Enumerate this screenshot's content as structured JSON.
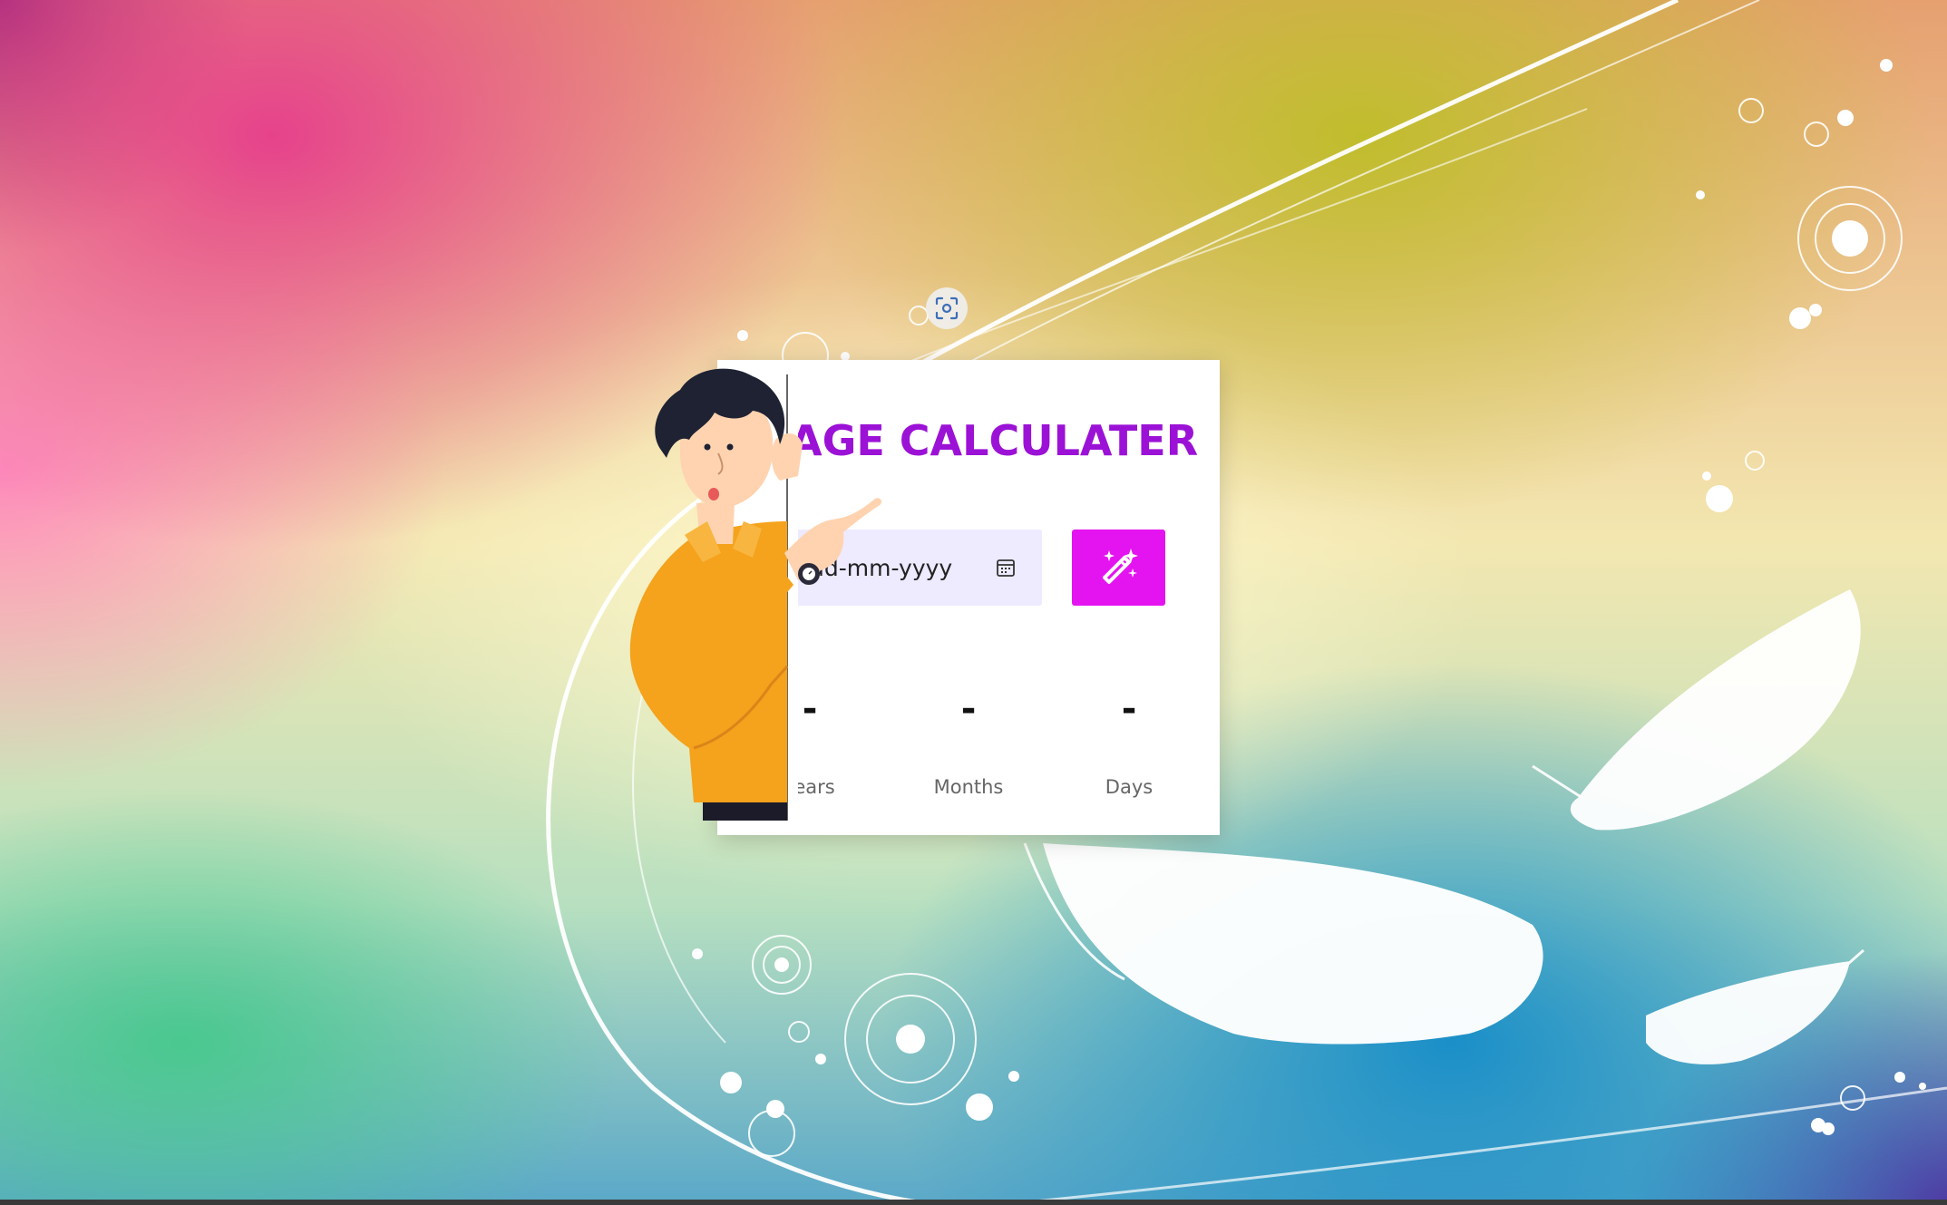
{
  "app": {
    "title": "AGE CALCULATER"
  },
  "date_input": {
    "placeholder": "dd-mm-yyyy",
    "visible_text": "mm-yyyy",
    "icon": "calendar-icon"
  },
  "calculate_button": {
    "icon": "magic-wand-icon",
    "color": "#e414f0"
  },
  "results": [
    {
      "value": "-",
      "label": "Years",
      "visible_label": "Years"
    },
    {
      "value": "-",
      "label": "Months",
      "visible_label": "Months"
    },
    {
      "value": "-",
      "label": "Days",
      "visible_label": "Days"
    }
  ],
  "colors": {
    "title": "#9b12d6",
    "input_bg": "#eeeaff",
    "button": "#e414f0",
    "shirt": "#f5a21c"
  },
  "overlay": {
    "screenshot_icon": "screenshot-focus-icon"
  }
}
